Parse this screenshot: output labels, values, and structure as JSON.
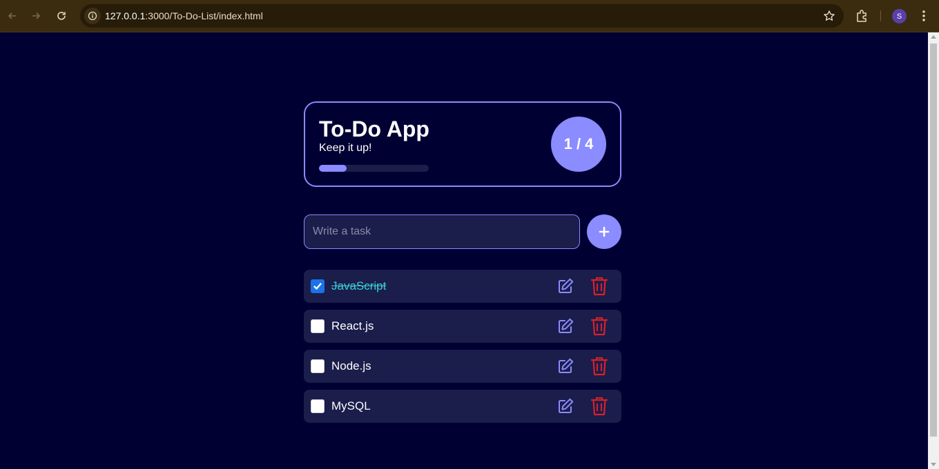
{
  "browser": {
    "url_host": "127.0.0.1",
    "url_path": ":3000/To-Do-List/index.html",
    "profile_initial": "S",
    "colors": {
      "frame": "#3b2c10",
      "omnibox": "#261c08"
    }
  },
  "header": {
    "title": "To-Do App",
    "subtitle": "Keep it up!",
    "progress_count": "1 / 4",
    "progress_fraction": 0.25
  },
  "input": {
    "placeholder": "Write a task",
    "value": "",
    "add_icon": "plus-icon"
  },
  "tasks": [
    {
      "label": "JavaScript",
      "done": true
    },
    {
      "label": "React.js",
      "done": false
    },
    {
      "label": "Node.js",
      "done": false
    },
    {
      "label": "MySQL",
      "done": false
    }
  ],
  "icons": {
    "edit": "edit-icon",
    "delete": "trash-icon"
  },
  "colors": {
    "background": "#000033",
    "accent": "#8a8cff",
    "surface": "#1b1d4b",
    "done_text": "#3ad0d6",
    "delete": "#d8202a",
    "checkbox_checked": "#1a73e8"
  }
}
